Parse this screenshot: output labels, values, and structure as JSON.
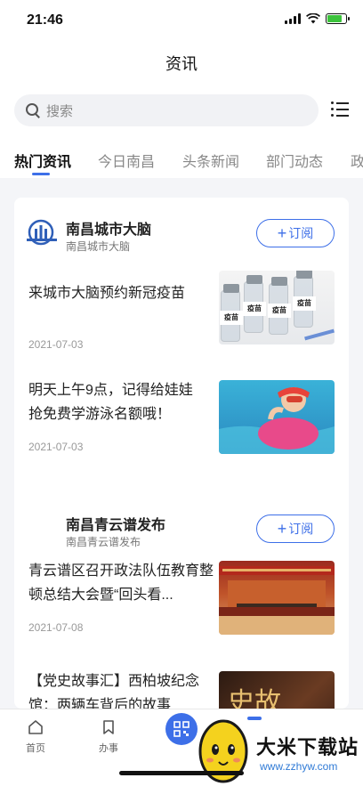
{
  "status_bar": {
    "time": "21:46"
  },
  "header": {
    "title": "资讯"
  },
  "search": {
    "placeholder": "搜索"
  },
  "tabs": [
    {
      "label": "热门资讯",
      "active": true
    },
    {
      "label": "今日南昌",
      "active": false
    },
    {
      "label": "头条新闻",
      "active": false
    },
    {
      "label": "部门动态",
      "active": false
    },
    {
      "label": "政",
      "active": false
    }
  ],
  "feed": [
    {
      "source_name": "南昌城市大脑",
      "source_sub": "南昌城市大脑",
      "subscribe_label": "订阅",
      "articles": [
        {
          "title": "来城市大脑预约新冠疫苗",
          "date": "2021-07-03",
          "thumb_labels": [
            "疫苗",
            "疫苗",
            "疫苗",
            "疫苗"
          ]
        },
        {
          "title": "明天上午9点，记得给娃娃抢免费学游泳名额哦！",
          "date": "2021-07-03"
        }
      ]
    },
    {
      "source_name": "南昌青云谱发布",
      "source_sub": "南昌青云谱发布",
      "subscribe_label": "订阅",
      "articles": [
        {
          "title": "青云谱区召开政法队伍教育整顿总结大会暨“回头看...",
          "date": "2021-07-08"
        },
        {
          "title": "【党史故事汇】西柏坡纪念馆：两辆车背后的故事",
          "date": "",
          "thumb_text": "史故"
        }
      ]
    }
  ],
  "bottom_nav": [
    {
      "label": "首页",
      "icon": "home-icon"
    },
    {
      "label": "办事",
      "icon": "bookmark-icon"
    },
    {
      "label": "",
      "icon": "qr-scan-icon"
    }
  ],
  "watermark": {
    "brand": "大米下载站",
    "url": "www.zzhyw.com"
  },
  "colors": {
    "accent": "#3d6fe8"
  }
}
